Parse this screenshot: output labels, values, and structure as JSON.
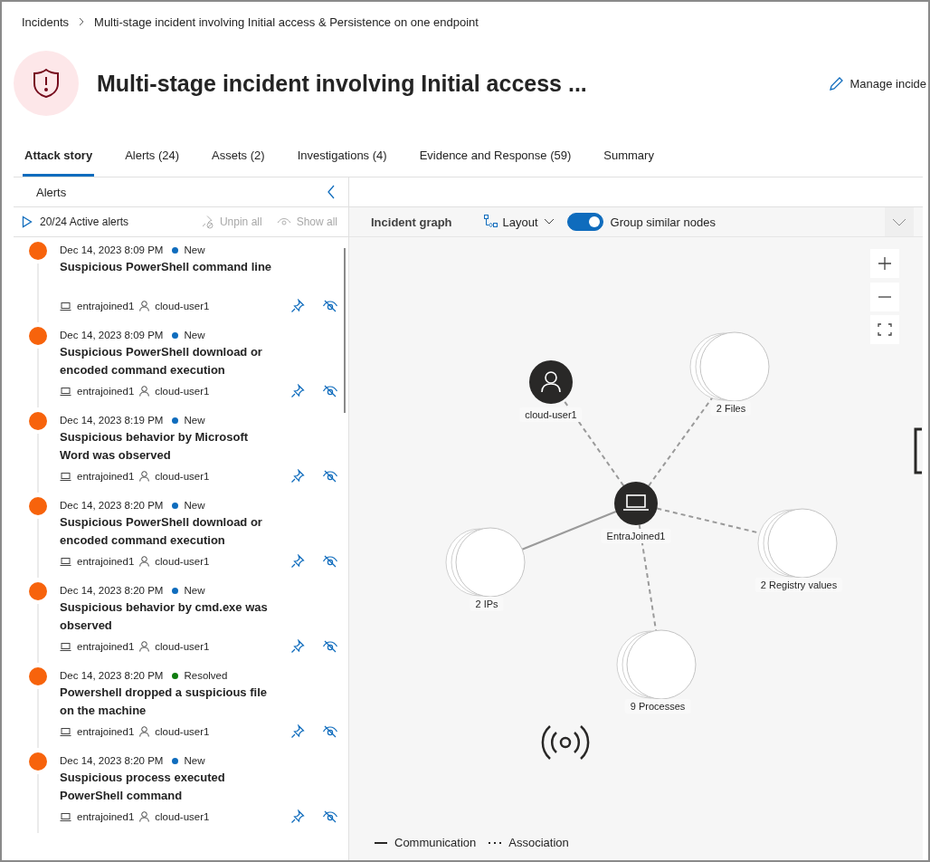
{
  "breadcrumb": [
    {
      "label": "Incidents"
    },
    {
      "label": "Multi-stage incident involving Initial access & Persistence on one endpoint"
    }
  ],
  "header": {
    "title": "Multi-stage incident involving Initial access ...",
    "action": "Manage incide"
  },
  "tabs": [
    {
      "label": "Attack story",
      "selected": true
    },
    {
      "label": "Alerts (24)",
      "selected": false
    },
    {
      "label": "Assets (2)",
      "selected": false
    },
    {
      "label": "Investigations (4)",
      "selected": false
    },
    {
      "label": "Evidence and Response (59)",
      "selected": false
    },
    {
      "label": "Summary",
      "selected": false
    }
  ],
  "alerts_panel": {
    "title": "Alerts",
    "count": "20/24 Active alerts",
    "unpin": "Unpin all",
    "show": "Show all",
    "alerts": [
      {
        "time": "Dec 14, 2023 8:09 PM",
        "status": "New",
        "color": "#0f6cbd",
        "title": "Suspicious PowerShell command line",
        "device": "entrajoined1",
        "user": "cloud-user1"
      },
      {
        "time": "Dec 14, 2023 8:09 PM",
        "status": "New",
        "color": "#0f6cbd",
        "title": "Suspicious PowerShell download or encoded command execution",
        "device": "entrajoined1",
        "user": "cloud-user1"
      },
      {
        "time": "Dec 14, 2023 8:19 PM",
        "status": "New",
        "color": "#0f6cbd",
        "title": "Suspicious behavior by Microsoft Word was observed",
        "device": "entrajoined1",
        "user": "cloud-user1"
      },
      {
        "time": "Dec 14, 2023 8:20 PM",
        "status": "New",
        "color": "#0f6cbd",
        "title": "Suspicious PowerShell download or encoded command execution",
        "device": "entrajoined1",
        "user": "cloud-user1"
      },
      {
        "time": "Dec 14, 2023 8:20 PM",
        "status": "New",
        "color": "#0f6cbd",
        "title": "Suspicious behavior by cmd.exe was observed",
        "device": "entrajoined1",
        "user": "cloud-user1"
      },
      {
        "time": "Dec 14, 2023 8:20 PM",
        "status": "Resolved",
        "color": "#107c10",
        "title": "Powershell dropped a suspicious file on the machine",
        "device": "entrajoined1",
        "user": "cloud-user1"
      },
      {
        "time": "Dec 14, 2023 8:20 PM",
        "status": "New",
        "color": "#0f6cbd",
        "title": "Suspicious process executed PowerShell command",
        "device": "entrajoined1",
        "user": "cloud-user1"
      }
    ]
  },
  "graph": {
    "title": "Incident graph",
    "layout": "Layout",
    "group_toggle": {
      "label": "Group similar nodes",
      "on": true
    },
    "nodes": [
      {
        "kind": "user",
        "label": "cloud-user1",
        "dashed_link": true
      },
      {
        "kind": "group",
        "label": "2 Files",
        "dashed_link": true
      },
      {
        "kind": "device",
        "label": "EntraJoined1"
      },
      {
        "kind": "group",
        "label": "2 Registry values",
        "dashed_link": true
      },
      {
        "kind": "group",
        "label": "2 IPs",
        "dashed_link": false
      },
      {
        "kind": "group",
        "label": "9 Processes",
        "dashed_link": true
      }
    ],
    "legend": [
      {
        "kind": "communication",
        "label": "Communication"
      },
      {
        "kind": "association",
        "label": "Association"
      }
    ]
  }
}
